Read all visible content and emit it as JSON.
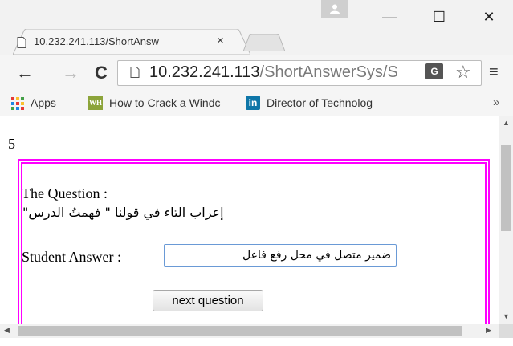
{
  "browser": {
    "tab_title": "10.232.241.113/ShortAnsw",
    "tab_close": "×",
    "window_controls": {
      "minimize": "—",
      "maximize": "☐",
      "close": "✕"
    },
    "nav": {
      "back": "←",
      "forward": "→",
      "reload": "C"
    },
    "url_host": "10.232.241.113",
    "url_path": "/ShortAnswerSys/S",
    "bookmarks": [
      {
        "label": "Apps",
        "icon": "apps-grid-icon"
      },
      {
        "label": "How to Crack a Windc",
        "icon": "wikihow-icon"
      },
      {
        "label": "Director of Technolog",
        "icon": "linkedin-icon"
      }
    ],
    "bookmarks_overflow": "»",
    "star": "☆",
    "menu": "≡",
    "translate_text": "G",
    "wikihow_text": "WH",
    "linkedin_text": "in"
  },
  "page": {
    "number": "5",
    "question_label": "The Question :",
    "question_text": "إعراب التاء في قولنا \" فهمتُ الدرس\"",
    "answer_label": "Student Answer  :",
    "answer_value": "ضمير متصل في محل رفع فاعل",
    "next_button": "next question"
  },
  "colors": {
    "frame_border": "#ff00ff",
    "input_border": "#6a9ad6"
  }
}
